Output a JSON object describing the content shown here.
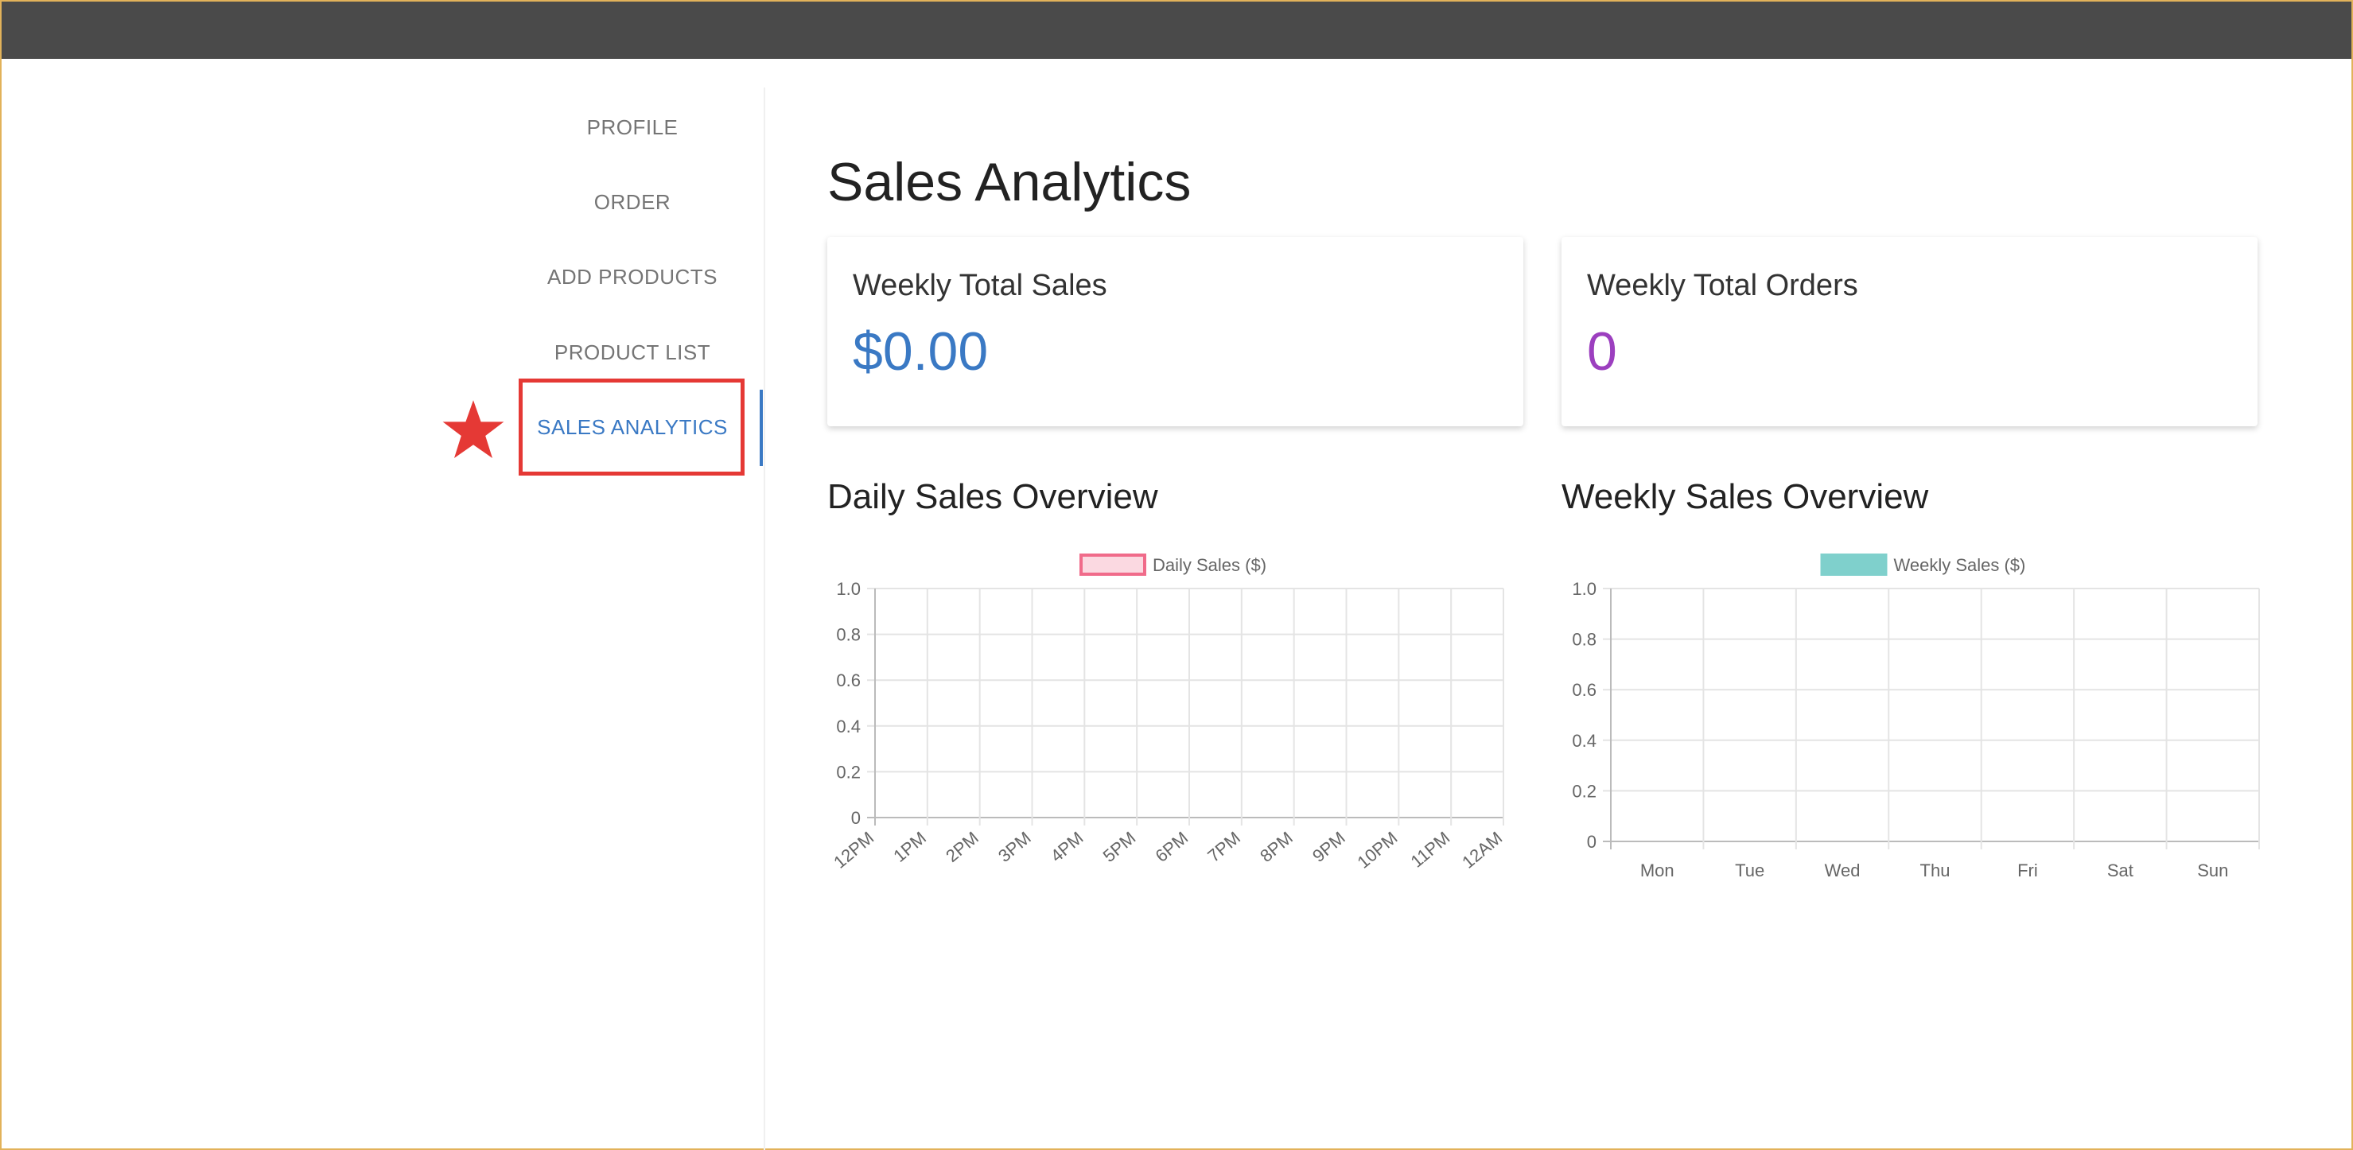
{
  "sidebar": {
    "items": [
      {
        "label": "PROFILE"
      },
      {
        "label": "ORDER"
      },
      {
        "label": "ADD PRODUCTS"
      },
      {
        "label": "PRODUCT LIST"
      },
      {
        "label": "SALES ANALYTICS",
        "active": true
      }
    ]
  },
  "main": {
    "title": "Sales Analytics",
    "cards": [
      {
        "label": "Weekly Total Sales",
        "value": "$0.00",
        "color": "#3a79c4"
      },
      {
        "label": "Weekly Total Orders",
        "value": "0",
        "color": "#9c3fbf"
      }
    ],
    "sections": {
      "daily": "Daily Sales Overview",
      "weekly": "Weekly Sales Overview"
    }
  },
  "colors": {
    "accent": "#3a79c4",
    "highlight": "#e53935",
    "topbar": "#4a4a4a",
    "daily_series": "#f06b8a",
    "weekly_series": "#7fd0cc"
  },
  "chart_data": [
    {
      "type": "bar",
      "series": [
        {
          "name": "Daily Sales ($)",
          "values": [
            0,
            0,
            0,
            0,
            0,
            0,
            0,
            0,
            0,
            0,
            0,
            0,
            0
          ]
        }
      ],
      "categories": [
        "12PM",
        "1PM",
        "2PM",
        "3PM",
        "4PM",
        "5PM",
        "6PM",
        "7PM",
        "8PM",
        "9PM",
        "10PM",
        "11PM",
        "12AM"
      ],
      "yticks": [
        "0",
        "0.2",
        "0.4",
        "0.6",
        "0.8",
        "1.0"
      ],
      "ylim": [
        0,
        1.0
      ],
      "grid": true,
      "legend": "top"
    },
    {
      "type": "bar",
      "series": [
        {
          "name": "Weekly Sales ($)",
          "values": [
            0,
            0,
            0,
            0,
            0,
            0,
            0
          ]
        }
      ],
      "categories": [
        "Mon",
        "Tue",
        "Wed",
        "Thu",
        "Fri",
        "Sat",
        "Sun"
      ],
      "yticks": [
        "0",
        "0.2",
        "0.4",
        "0.6",
        "0.8",
        "1.0"
      ],
      "ylim": [
        0,
        1.0
      ],
      "grid": true,
      "legend": "top"
    }
  ]
}
